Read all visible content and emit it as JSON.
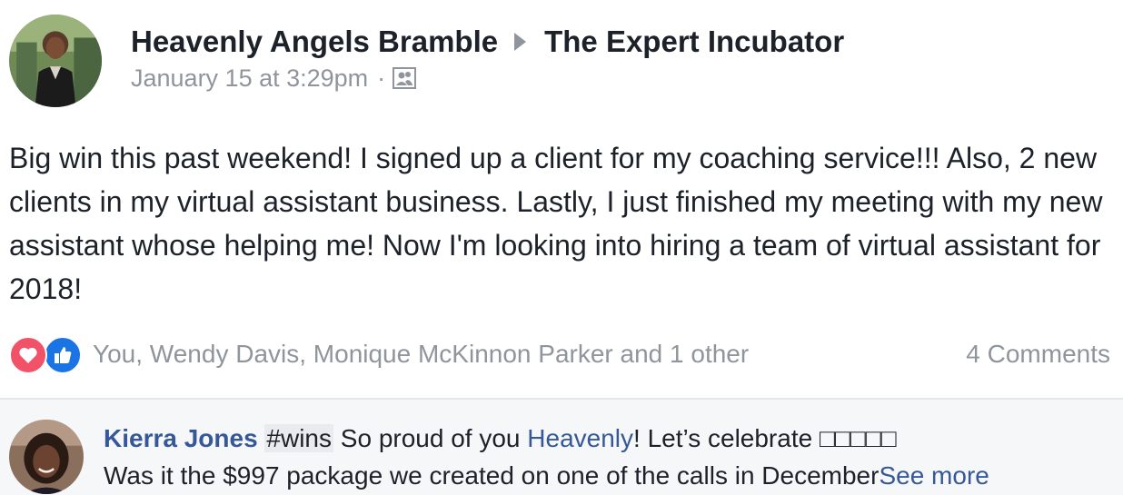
{
  "post": {
    "author": "Heavenly Angels Bramble",
    "group": "The Expert Incubator",
    "timestamp": "January 15 at 3:29pm",
    "separator": "·",
    "audience_icon": "members-icon",
    "text": "Big win this past weekend! I signed up a client for my coaching service!!! Also, 2 new clients in my virtual assistant business. Lastly, I just finished my meeting with my new assistant whose helping me! Now I'm looking into hiring a team of virtual assistant for 2018!"
  },
  "reactions": {
    "icons": [
      "love-icon",
      "like-icon"
    ],
    "summary": "You, Wendy Davis, Monique McKinnon Parker and 1 other",
    "comments_count": "4 Comments"
  },
  "comment": {
    "author": "Kierra Jones",
    "hashtag": "#wins",
    "text_1": " So proud of you ",
    "mention": "Heavenly",
    "text_2": "! Let’s celebrate □□□□□",
    "line2": "Was it the $997 package we created on one of the calls in December",
    "see_more": "See more"
  },
  "colors": {
    "link": "#365899",
    "muted": "#90949c",
    "text": "#1d2129",
    "love": "#f25268",
    "like": "#1b74e4",
    "comment_bg": "#f6f7f9"
  }
}
